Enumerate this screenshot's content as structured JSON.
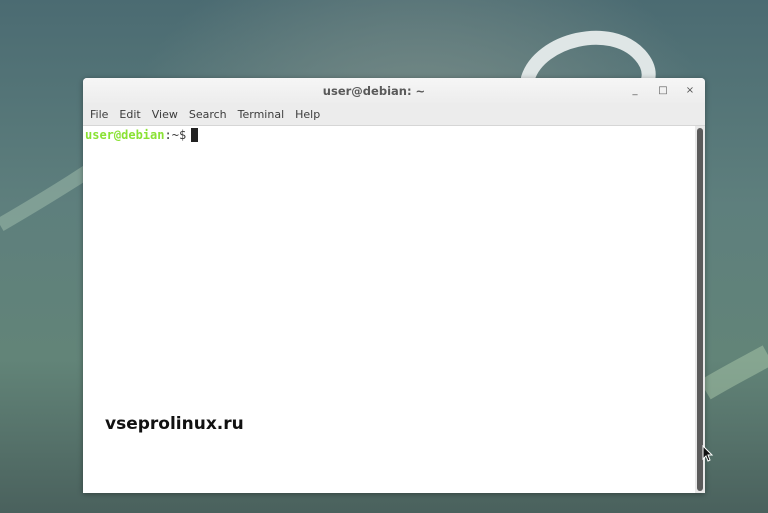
{
  "desktop": {
    "wallpaper": "debian-swirl",
    "accent_colors": {
      "prompt_user": "#8ae234",
      "scrollbar_thumb": "#5b5b5b"
    }
  },
  "window": {
    "title": "user@debian: ~",
    "controls": {
      "minimize": "_",
      "maximize": "□",
      "close": "×"
    },
    "menu": [
      {
        "label": "File"
      },
      {
        "label": "Edit"
      },
      {
        "label": "View"
      },
      {
        "label": "Search"
      },
      {
        "label": "Terminal"
      },
      {
        "label": "Help"
      }
    ],
    "terminal": {
      "prompt_user": "user@debian",
      "prompt_sep": ":",
      "prompt_path": "~$"
    }
  },
  "watermark": "vseprolinux.ru"
}
